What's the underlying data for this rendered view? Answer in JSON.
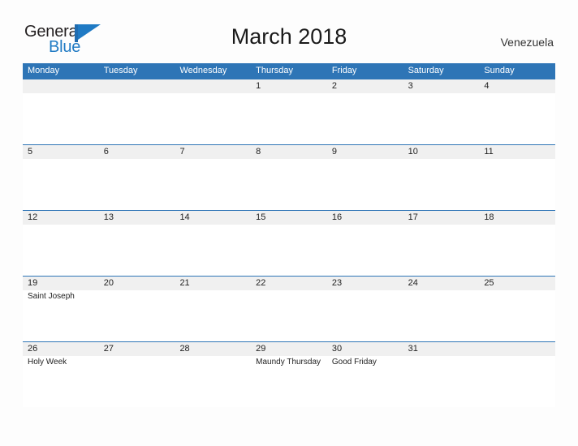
{
  "brand": {
    "name_part1": "General",
    "name_part2": "Blue",
    "flag_icon": "blue-flag-icon",
    "accent_color": "#1f7ac4"
  },
  "header": {
    "title": "March 2018",
    "region": "Venezuela"
  },
  "theme": {
    "header_blue": "#2e75b6",
    "date_band_gray": "#f0f0f0",
    "page_background": "#fdfdfd",
    "text_color": "#222222"
  },
  "calendar": {
    "month": "March",
    "year": "2018",
    "weekday_headers": [
      "Monday",
      "Tuesday",
      "Wednesday",
      "Thursday",
      "Friday",
      "Saturday",
      "Sunday"
    ],
    "weeks": [
      [
        {
          "date": "",
          "event": ""
        },
        {
          "date": "",
          "event": ""
        },
        {
          "date": "",
          "event": ""
        },
        {
          "date": "1",
          "event": ""
        },
        {
          "date": "2",
          "event": ""
        },
        {
          "date": "3",
          "event": ""
        },
        {
          "date": "4",
          "event": ""
        }
      ],
      [
        {
          "date": "5",
          "event": ""
        },
        {
          "date": "6",
          "event": ""
        },
        {
          "date": "7",
          "event": ""
        },
        {
          "date": "8",
          "event": ""
        },
        {
          "date": "9",
          "event": ""
        },
        {
          "date": "10",
          "event": ""
        },
        {
          "date": "11",
          "event": ""
        }
      ],
      [
        {
          "date": "12",
          "event": ""
        },
        {
          "date": "13",
          "event": ""
        },
        {
          "date": "14",
          "event": ""
        },
        {
          "date": "15",
          "event": ""
        },
        {
          "date": "16",
          "event": ""
        },
        {
          "date": "17",
          "event": ""
        },
        {
          "date": "18",
          "event": ""
        }
      ],
      [
        {
          "date": "19",
          "event": "Saint Joseph"
        },
        {
          "date": "20",
          "event": ""
        },
        {
          "date": "21",
          "event": ""
        },
        {
          "date": "22",
          "event": ""
        },
        {
          "date": "23",
          "event": ""
        },
        {
          "date": "24",
          "event": ""
        },
        {
          "date": "25",
          "event": ""
        }
      ],
      [
        {
          "date": "26",
          "event": "Holy Week"
        },
        {
          "date": "27",
          "event": ""
        },
        {
          "date": "28",
          "event": ""
        },
        {
          "date": "29",
          "event": "Maundy Thursday"
        },
        {
          "date": "30",
          "event": "Good Friday"
        },
        {
          "date": "31",
          "event": ""
        },
        {
          "date": "",
          "event": ""
        }
      ]
    ]
  }
}
